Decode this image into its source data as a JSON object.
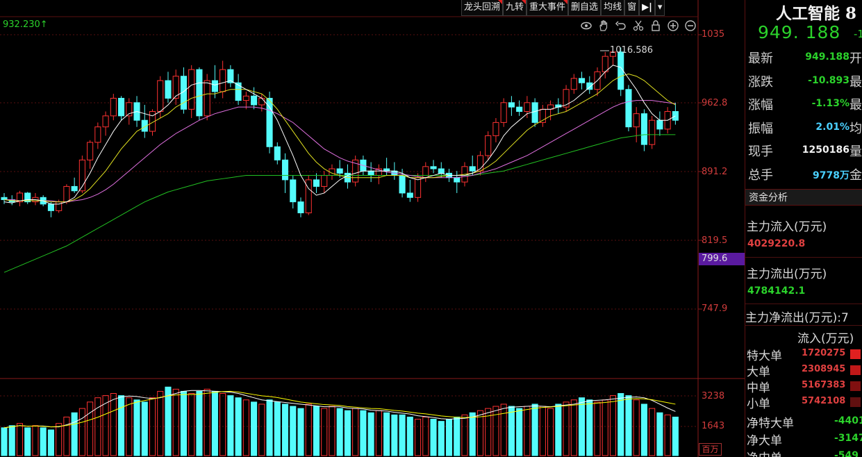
{
  "toolbar": [
    "龙头回溯",
    "九转",
    "重大事件",
    "删自选",
    "均线",
    "窗"
  ],
  "toolbar_icons": [
    "eye-icon",
    "hand-icon",
    "undo-icon",
    "scissors-icon",
    "lock-icon",
    "zoom-in-icon",
    "zoom-out-icon"
  ],
  "chart": {
    "max_label": "932.230↑",
    "peak_label": "1016.586",
    "price_axis": [
      "1035",
      "962.8",
      "891.2",
      "819.5",
      "747.9"
    ],
    "current_tag": "799.6",
    "vol_axis": [
      "3238",
      "1643"
    ],
    "vol_unit": "百万"
  },
  "chart_data": {
    "type": "candlestick",
    "ylim": [
      717,
      1044
    ],
    "candles": [
      [
        880,
        884,
        874,
        878
      ],
      [
        878,
        882,
        873,
        876
      ],
      [
        876,
        886,
        872,
        884
      ],
      [
        884,
        885,
        874,
        876
      ],
      [
        876,
        884,
        873,
        880
      ],
      [
        880,
        882,
        872,
        874
      ],
      [
        874,
        876,
        862,
        868
      ],
      [
        868,
        878,
        866,
        876
      ],
      [
        876,
        892,
        874,
        890
      ],
      [
        890,
        898,
        884,
        886
      ],
      [
        886,
        918,
        884,
        914
      ],
      [
        914,
        932,
        906,
        930
      ],
      [
        930,
        948,
        924,
        944
      ],
      [
        944,
        958,
        936,
        954
      ],
      [
        954,
        974,
        950,
        970
      ],
      [
        970,
        972,
        950,
        954
      ],
      [
        954,
        970,
        946,
        966
      ],
      [
        966,
        972,
        944,
        950
      ],
      [
        950,
        964,
        934,
        940
      ],
      [
        940,
        960,
        936,
        958
      ],
      [
        958,
        990,
        952,
        986
      ],
      [
        986,
        994,
        966,
        970
      ],
      [
        970,
        996,
        964,
        990
      ],
      [
        990,
        998,
        956,
        960
      ],
      [
        960,
        1000,
        952,
        996
      ],
      [
        996,
        998,
        950,
        954
      ],
      [
        954,
        992,
        950,
        986
      ],
      [
        986,
        1000,
        970,
        976
      ],
      [
        976,
        1004,
        970,
        996
      ],
      [
        996,
        1000,
        980,
        984
      ],
      [
        984,
        992,
        964,
        968
      ],
      [
        968,
        976,
        960,
        972
      ],
      [
        972,
        980,
        960,
        964
      ],
      [
        964,
        974,
        958,
        970
      ],
      [
        970,
        976,
        920,
        926
      ],
      [
        926,
        930,
        910,
        914
      ],
      [
        914,
        920,
        884,
        896
      ],
      [
        896,
        900,
        870,
        876
      ],
      [
        876,
        880,
        862,
        866
      ],
      [
        866,
        900,
        864,
        896
      ],
      [
        896,
        902,
        884,
        890
      ],
      [
        890,
        904,
        884,
        900
      ],
      [
        900,
        910,
        896,
        906
      ],
      [
        906,
        914,
        898,
        902
      ],
      [
        902,
        910,
        888,
        894
      ],
      [
        894,
        918,
        890,
        914
      ],
      [
        914,
        918,
        900,
        904
      ],
      [
        904,
        912,
        894,
        900
      ],
      [
        900,
        910,
        892,
        906
      ],
      [
        906,
        916,
        900,
        904
      ],
      [
        904,
        912,
        896,
        900
      ],
      [
        900,
        906,
        880,
        884
      ],
      [
        884,
        896,
        876,
        880
      ],
      [
        880,
        902,
        876,
        898
      ],
      [
        898,
        912,
        894,
        908
      ],
      [
        908,
        914,
        902,
        906
      ],
      [
        906,
        912,
        898,
        902
      ],
      [
        902,
        906,
        894,
        898
      ],
      [
        898,
        904,
        884,
        894
      ],
      [
        894,
        912,
        890,
        908
      ],
      [
        908,
        918,
        900,
        904
      ],
      [
        904,
        922,
        900,
        918
      ],
      [
        918,
        940,
        914,
        936
      ],
      [
        936,
        952,
        930,
        948
      ],
      [
        948,
        970,
        944,
        966
      ],
      [
        966,
        972,
        954,
        962
      ],
      [
        962,
        968,
        954,
        958
      ],
      [
        958,
        972,
        952,
        966
      ],
      [
        966,
        970,
        944,
        948
      ],
      [
        948,
        964,
        944,
        960
      ],
      [
        960,
        968,
        950,
        964
      ],
      [
        964,
        970,
        956,
        962
      ],
      [
        962,
        982,
        958,
        978
      ],
      [
        978,
        992,
        974,
        988
      ],
      [
        988,
        994,
        978,
        984
      ],
      [
        984,
        990,
        974,
        978
      ],
      [
        978,
        998,
        972,
        994
      ],
      [
        994,
        1012,
        988,
        1008
      ],
      [
        1008,
        1016,
        1000,
        1012
      ],
      [
        1012,
        1016,
        972,
        978
      ],
      [
        978,
        982,
        940,
        944
      ],
      [
        944,
        962,
        930,
        956
      ],
      [
        956,
        960,
        922,
        928
      ],
      [
        928,
        954,
        924,
        950
      ],
      [
        950,
        958,
        936,
        942
      ],
      [
        942,
        962,
        938,
        958
      ],
      [
        958,
        966,
        946,
        950
      ]
    ],
    "ma_white": [
      876,
      875,
      877,
      878,
      878,
      877,
      874,
      874,
      876,
      880,
      890,
      902,
      916,
      928,
      940,
      950,
      956,
      958,
      956,
      954,
      958,
      964,
      972,
      976,
      982,
      984,
      984,
      982,
      984,
      986,
      982,
      978,
      974,
      970,
      962,
      950,
      934,
      918,
      900,
      888,
      882,
      884,
      890,
      896,
      900,
      902,
      904,
      904,
      904,
      904,
      904,
      902,
      898,
      896,
      898,
      900,
      902,
      900,
      900,
      900,
      902,
      906,
      914,
      924,
      936,
      944,
      950,
      956,
      958,
      960,
      960,
      962,
      964,
      968,
      974,
      980,
      986,
      994,
      1000,
      998,
      988,
      978,
      966,
      956,
      950,
      950,
      954
    ],
    "ma_yellow": [
      878,
      877,
      877,
      877,
      877,
      877,
      876,
      876,
      876,
      878,
      882,
      888,
      896,
      904,
      914,
      924,
      932,
      940,
      944,
      948,
      952,
      956,
      962,
      966,
      970,
      972,
      974,
      974,
      976,
      978,
      978,
      978,
      976,
      974,
      968,
      960,
      950,
      940,
      930,
      920,
      912,
      906,
      902,
      900,
      898,
      898,
      898,
      898,
      898,
      900,
      900,
      900,
      898,
      898,
      898,
      898,
      899,
      900,
      900,
      901,
      902,
      904,
      908,
      913,
      920,
      927,
      934,
      941,
      946,
      950,
      954,
      956,
      958,
      962,
      966,
      970,
      974,
      980,
      986,
      990,
      992,
      990,
      986,
      980,
      974,
      968,
      964
    ],
    "ma_pink": [
      878,
      878,
      877,
      877,
      877,
      877,
      877,
      876,
      876,
      877,
      878,
      880,
      883,
      887,
      892,
      898,
      904,
      910,
      916,
      922,
      928,
      933,
      938,
      942,
      946,
      950,
      953,
      956,
      958,
      960,
      962,
      962,
      962,
      961,
      959,
      956,
      952,
      948,
      942,
      936,
      930,
      924,
      920,
      916,
      913,
      911,
      909,
      907,
      905,
      903,
      902,
      901,
      900,
      899,
      898,
      898,
      898,
      898,
      898,
      899,
      900,
      902,
      904,
      906,
      909,
      912,
      915,
      918,
      922,
      926,
      930,
      934,
      938,
      942,
      946,
      950,
      954,
      958,
      962,
      965,
      967,
      968,
      968,
      968,
      967,
      966,
      965
    ],
    "ma_green": [
      812,
      815,
      818,
      821,
      824,
      827,
      830,
      833,
      836,
      840,
      844,
      848,
      852,
      856,
      860,
      864,
      868,
      872,
      876,
      879,
      882,
      885,
      887,
      889,
      891,
      893,
      895,
      896,
      897,
      898,
      899,
      900,
      900,
      900,
      900,
      900,
      900,
      900,
      900,
      900,
      900,
      900,
      900,
      900,
      900,
      900,
      900,
      900,
      900,
      900,
      900,
      900,
      900,
      900,
      900,
      900,
      900,
      900,
      900,
      900,
      900,
      901,
      902,
      903,
      904,
      906,
      908,
      910,
      912,
      914,
      916,
      918,
      920,
      922,
      924,
      926,
      928,
      930,
      932,
      934,
      935,
      936,
      937,
      937,
      937,
      937,
      937
    ],
    "volume": [
      1300,
      1400,
      1500,
      1300,
      1400,
      1300,
      1200,
      1500,
      1800,
      2000,
      2200,
      2500,
      2700,
      2800,
      2900,
      2800,
      2700,
      2600,
      2500,
      2700,
      3000,
      3200,
      3100,
      3000,
      2900,
      3000,
      3100,
      3000,
      2900,
      2800,
      2700,
      2600,
      2500,
      2400,
      2600,
      2500,
      2400,
      2300,
      2200,
      2400,
      2300,
      2200,
      2300,
      2200,
      2100,
      2200,
      2100,
      2000,
      2100,
      2000,
      1900,
      1900,
      1800,
      1700,
      1800,
      1700,
      1600,
      1700,
      1800,
      1900,
      2000,
      2100,
      2200,
      2300,
      2400,
      2300,
      2200,
      2300,
      2400,
      2300,
      2200,
      2400,
      2500,
      2600,
      2700,
      2600,
      2500,
      2600,
      2800,
      2900,
      2800,
      2600,
      2400,
      2200,
      2000,
      1900,
      1800
    ],
    "vol_ylim": [
      0,
      3500
    ]
  },
  "panel": {
    "name": "人工智能 8",
    "price": "949. 188",
    "change": "-1",
    "quotes": [
      {
        "k": "最新",
        "v": "949.188",
        "c": "#2bd22b",
        "k2": "开"
      },
      {
        "k": "涨跌",
        "v": "-10.893",
        "c": "#2bd22b",
        "k2": "最"
      },
      {
        "k": "涨幅",
        "v": "-1.13%",
        "c": "#2bd22b",
        "k2": "最"
      },
      {
        "k": "振幅",
        "v": "2.01%",
        "c": "#4ad0ff",
        "k2": "均"
      },
      {
        "k": "现手",
        "v": "1250186",
        "c": "#f0f0f0",
        "k2": "量"
      },
      {
        "k": "总手",
        "v": "9778万",
        "c": "#4ad0ff",
        "k2": "金"
      }
    ],
    "section": "资金分析",
    "inflow_title": "主力流入(万元)",
    "inflow_value": "4029220.8",
    "outflow_title": "主力流出(万元)",
    "outflow_value": "4784142.1",
    "net_title": "主力净流出(万元):7",
    "flow_header": "流入(万元)",
    "tiers": [
      {
        "k": "特大单",
        "v": "1720275",
        "bar": "#e02020"
      },
      {
        "k": "大单",
        "v": "2308945",
        "bar": "#c01818"
      },
      {
        "k": "中单",
        "v": "5167383",
        "bar": "#801010"
      },
      {
        "k": "小单",
        "v": "5742108",
        "bar": "#601010"
      }
    ],
    "nets": [
      {
        "k": "净特大单",
        "v": "-4401"
      },
      {
        "k": "净大单",
        "v": "-3147"
      },
      {
        "k": "净中单",
        "v": "-549"
      }
    ]
  }
}
